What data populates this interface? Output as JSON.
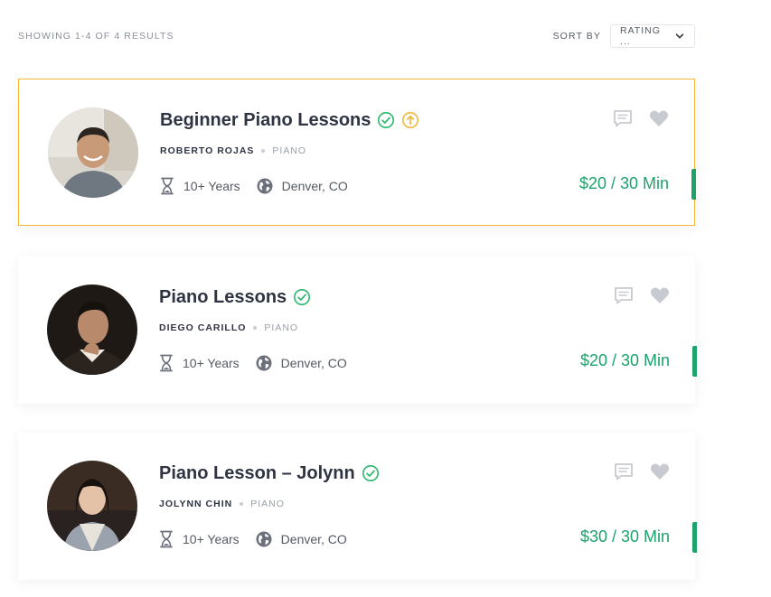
{
  "results": {
    "showing_text": "SHOWING 1-4 OF 4 RESULTS",
    "sort_label": "SORT BY",
    "sort_value": "RATING ..."
  },
  "colors": {
    "featured_border": "#f2b63a",
    "price": "#1ca36c",
    "verified": "#27b86b",
    "promoted": "#f2b63a",
    "muted_icon": "#c7cad1"
  },
  "listings": [
    {
      "title": "Beginner Piano Lessons",
      "teacher": "ROBERTO ROJAS",
      "instrument": "PIANO",
      "experience": "10+ Years",
      "location": "Denver, CO",
      "price": "$20 / 30 Min",
      "verified": true,
      "promoted": true,
      "featured": true
    },
    {
      "title": "Piano Lessons",
      "teacher": "DIEGO CARILLO",
      "instrument": "PIANO",
      "experience": "10+ Years",
      "location": "Denver, CO",
      "price": "$20 / 30 Min",
      "verified": true,
      "promoted": false,
      "featured": false
    },
    {
      "title": "Piano Lesson – Jolynn",
      "teacher": "JOLYNN CHIN",
      "instrument": "PIANO",
      "experience": "10+ Years",
      "location": "Denver, CO",
      "price": "$30 / 30 Min",
      "verified": true,
      "promoted": false,
      "featured": false
    }
  ]
}
